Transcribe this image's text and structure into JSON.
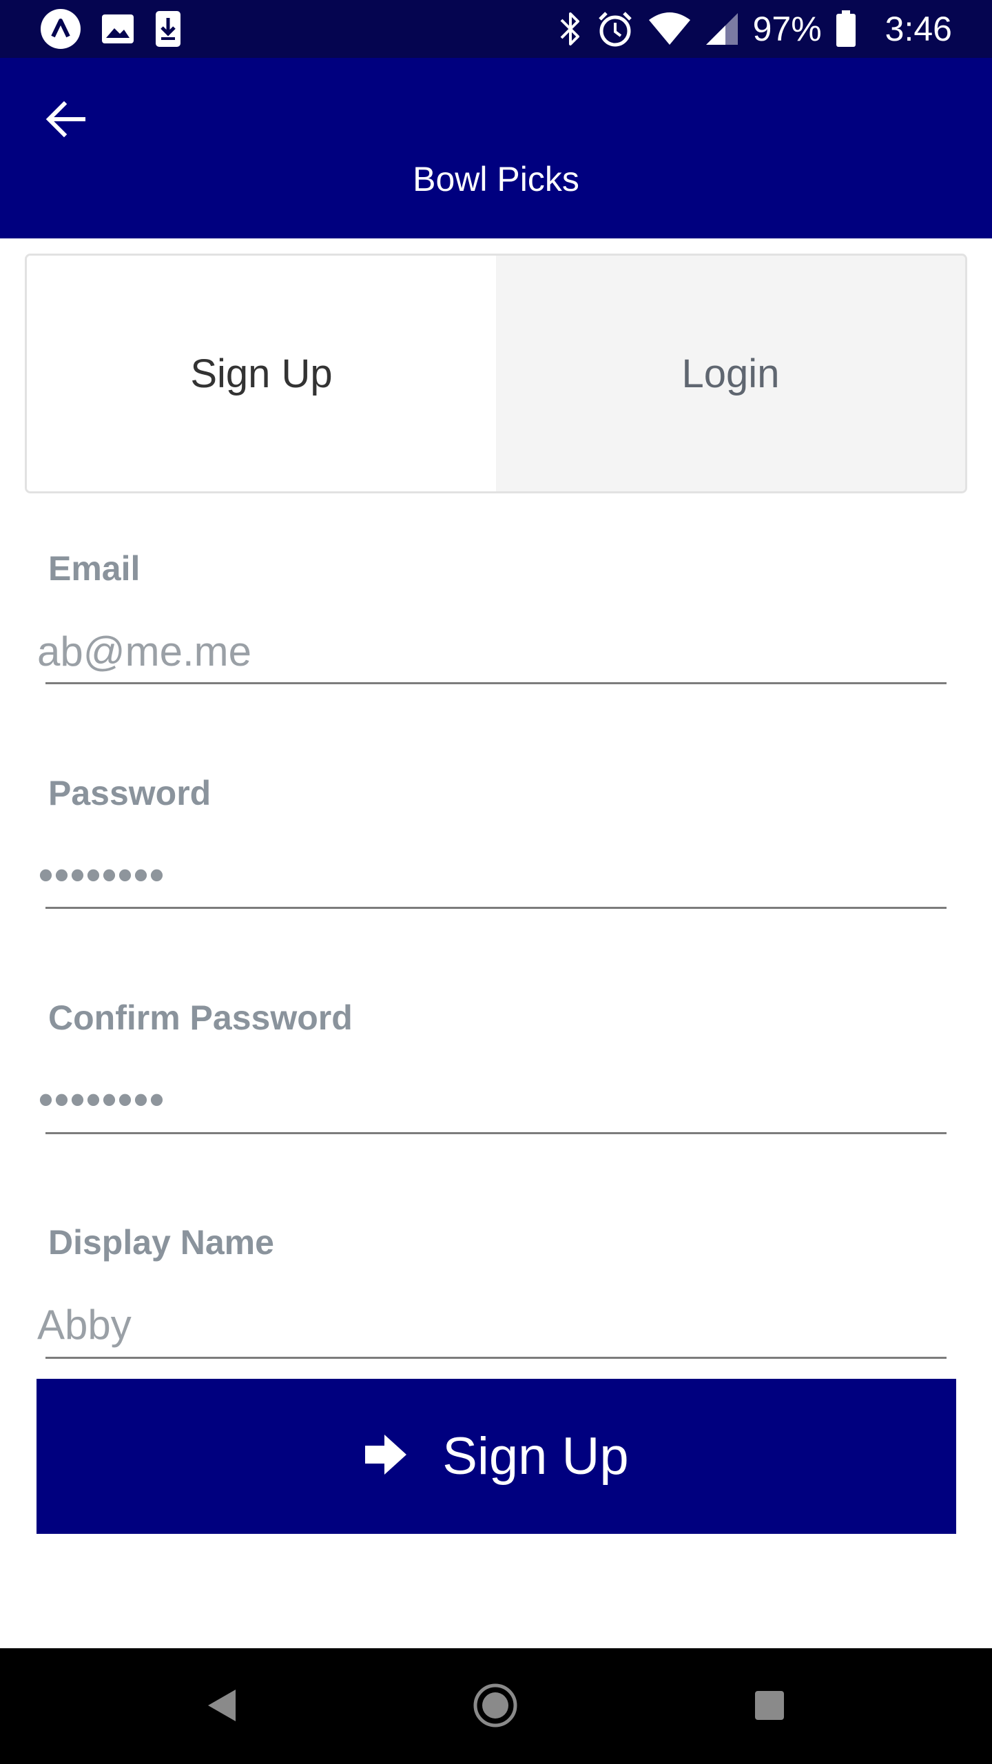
{
  "status_bar": {
    "left_icons": [
      "app-logo-icon",
      "image-icon",
      "download-icon"
    ],
    "right_icons": [
      "bluetooth-icon",
      "alarm-icon",
      "wifi-icon",
      "signal-icon",
      "battery-icon"
    ],
    "battery_percent": "97%",
    "time": "3:46"
  },
  "app_bar": {
    "title": "Bowl Picks",
    "back_icon": "back-arrow-icon"
  },
  "tabs": {
    "signup_label": "Sign Up",
    "login_label": "Login",
    "selected": "Sign Up"
  },
  "form": {
    "email": {
      "label": "Email",
      "value": "ab@me.me"
    },
    "password": {
      "label": "Password",
      "value": "••••••••"
    },
    "confirm_password": {
      "label": "Confirm Password",
      "value": "••••••••"
    },
    "display_name": {
      "label": "Display Name",
      "value": "Abby"
    }
  },
  "submit": {
    "label": "Sign Up",
    "icon": "arrow-right-icon"
  },
  "nav_bar": {
    "icons": [
      "nav-back-icon",
      "nav-home-icon",
      "nav-recents-icon"
    ]
  },
  "colors": {
    "status_bar": "#050550",
    "app_bar": "#00007f",
    "button": "#00007f",
    "label": "#8a939c"
  }
}
